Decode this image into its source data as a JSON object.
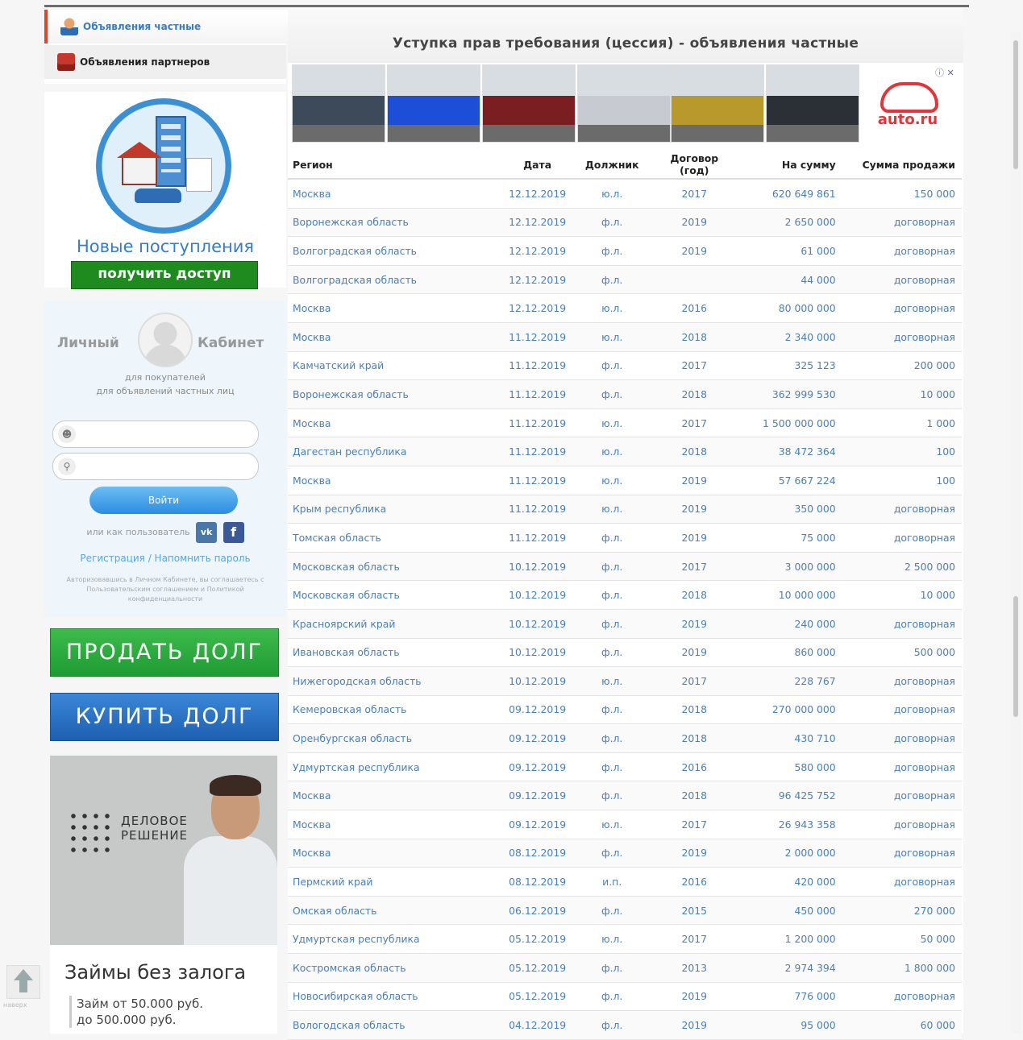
{
  "tabs": {
    "private_ads": "Объявления частные",
    "partner_ads": "Объявления партнеров"
  },
  "news": {
    "title": "Новые поступления",
    "access_button": "получить доступ"
  },
  "cabinet": {
    "title_left": "Личный",
    "title_right": "Кабинет",
    "subtitle_line1": "для покупателей",
    "subtitle_line2": "для объявлений частных лиц",
    "login_button": "Войти",
    "social_prefix": "или как пользователь",
    "vk_label": "vk",
    "fb_label": "f",
    "register_link": "Регистрация / Напомнить пароль",
    "disclaimer": "Авторизовавшись в Личном Кабинете, вы соглашаетесь с Пользовательским соглашением и Политикой конфиденциальности"
  },
  "actions": {
    "sell": "ПРОДАТЬ ДОЛГ",
    "buy": "КУПИТЬ ДОЛГ"
  },
  "side_ad": {
    "brand_line1": "ДЕЛОВОЕ",
    "brand_line2": "РЕШЕНИЕ",
    "title": "Займы без залога",
    "sub_line1": "Займ от 50.000 руб.",
    "sub_line2": "до 500.000 руб."
  },
  "up_label": "наверх",
  "page_title": "Уступка прав требования (цессия) - объявления частные",
  "banner_ad": {
    "brand": "auto.ru",
    "marker": "ⓘ ✕",
    "thumb_colors": [
      "#3c4a5a",
      "#1d4ed8",
      "#7a1e22",
      "#c7cbd1",
      "#b89a2c",
      "#2b2f36"
    ]
  },
  "table": {
    "headers": [
      "Регион",
      "Дата",
      "Должник",
      "Договор (год)",
      "На сумму",
      "Сумма продажи"
    ],
    "rows": [
      [
        "Москва",
        "12.12.2019",
        "ю.л.",
        "2017",
        "620 649 861",
        "150 000"
      ],
      [
        "Воронежская область",
        "12.12.2019",
        "ф.л.",
        "2019",
        "2 650 000",
        "договорная"
      ],
      [
        "Волгоградская область",
        "12.12.2019",
        "ф.л.",
        "2019",
        "61 000",
        "договорная"
      ],
      [
        "Волгоградская область",
        "12.12.2019",
        "ф.л.",
        "",
        "44 000",
        "договорная"
      ],
      [
        "Москва",
        "12.12.2019",
        "ю.л.",
        "2016",
        "80 000 000",
        "договорная"
      ],
      [
        "Москва",
        "11.12.2019",
        "ю.л.",
        "2018",
        "2 340 000",
        "договорная"
      ],
      [
        "Камчатский край",
        "11.12.2019",
        "ф.л.",
        "2017",
        "325 123",
        "200 000"
      ],
      [
        "Воронежская область",
        "11.12.2019",
        "ф.л.",
        "2018",
        "362 999 530",
        "10 000"
      ],
      [
        "Москва",
        "11.12.2019",
        "ю.л.",
        "2017",
        "1 500 000 000",
        "1 000"
      ],
      [
        "Дагестан республика",
        "11.12.2019",
        "ю.л.",
        "2018",
        "38 472 364",
        "100"
      ],
      [
        "Москва",
        "11.12.2019",
        "ю.л.",
        "2019",
        "57 667 224",
        "100"
      ],
      [
        "Крым республика",
        "11.12.2019",
        "ю.л.",
        "2019",
        "350 000",
        "договорная"
      ],
      [
        "Томская область",
        "11.12.2019",
        "ф.л.",
        "2019",
        "75 000",
        "договорная"
      ],
      [
        "Московская область",
        "10.12.2019",
        "ф.л.",
        "2017",
        "3 000 000",
        "2 500 000"
      ],
      [
        "Московская область",
        "10.12.2019",
        "ф.л.",
        "2018",
        "10 000 000",
        "10 000"
      ],
      [
        "Красноярский край",
        "10.12.2019",
        "ф.л.",
        "2019",
        "240 000",
        "договорная"
      ],
      [
        "Ивановская область",
        "10.12.2019",
        "ф.л.",
        "2019",
        "860 000",
        "500 000"
      ],
      [
        "Нижегородская область",
        "10.12.2019",
        "ю.л.",
        "2017",
        "228 767",
        "договорная"
      ],
      [
        "Кемеровская область",
        "09.12.2019",
        "ф.л.",
        "2018",
        "270 000 000",
        "договорная"
      ],
      [
        "Оренбургская область",
        "09.12.2019",
        "ф.л.",
        "2018",
        "430 710",
        "договорная"
      ],
      [
        "Удмуртская республика",
        "09.12.2019",
        "ф.л.",
        "2016",
        "580 000",
        "договорная"
      ],
      [
        "Москва",
        "09.12.2019",
        "ф.л.",
        "2018",
        "96 425 752",
        "договорная"
      ],
      [
        "Москва",
        "09.12.2019",
        "ю.л.",
        "2017",
        "26 943 358",
        "договорная"
      ],
      [
        "Москва",
        "08.12.2019",
        "ф.л.",
        "2019",
        "2 000 000",
        "договорная"
      ],
      [
        "Пермский край",
        "08.12.2019",
        "и.п.",
        "2016",
        "420 000",
        "договорная"
      ],
      [
        "Омская область",
        "06.12.2019",
        "ф.л.",
        "2015",
        "450 000",
        "270 000"
      ],
      [
        "Удмуртская республика",
        "05.12.2019",
        "ю.л.",
        "2017",
        "1 200 000",
        "50 000"
      ],
      [
        "Костромская область",
        "05.12.2019",
        "ф.л.",
        "2013",
        "2 974 394",
        "1 800 000"
      ],
      [
        "Новосибирская область",
        "05.12.2019",
        "ф.л.",
        "2019",
        "776 000",
        "договорная"
      ],
      [
        "Вологодская область",
        "04.12.2019",
        "ф.л.",
        "2019",
        "95 000",
        "60 000"
      ]
    ]
  }
}
